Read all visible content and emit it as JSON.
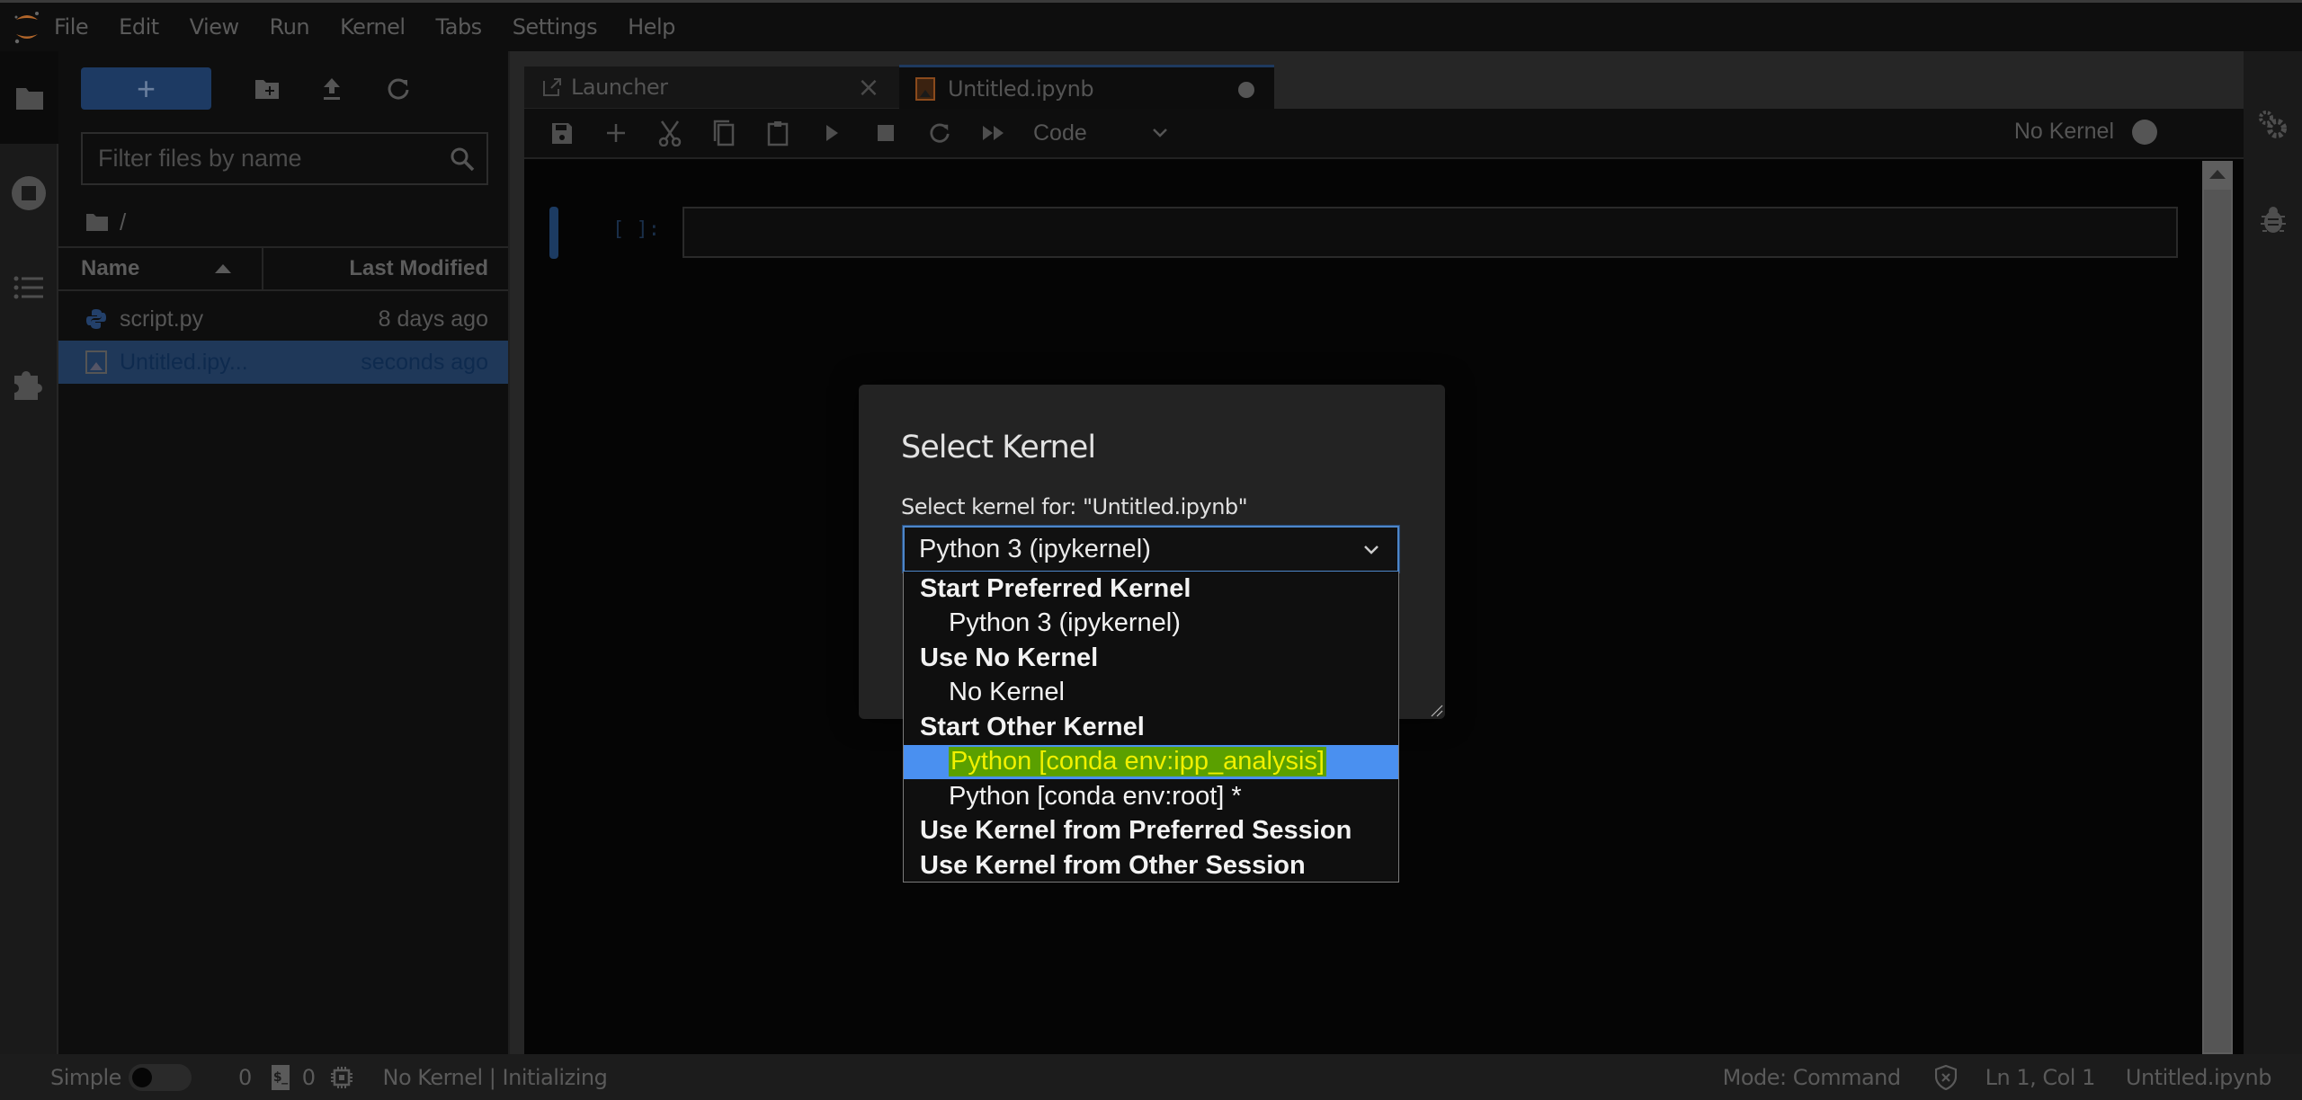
{
  "app": {
    "name": "JupyterLab",
    "accent": "#1d3a63",
    "highlight": "#4a90f0"
  },
  "menubar": {
    "items": [
      "File",
      "Edit",
      "View",
      "Run",
      "Kernel",
      "Tabs",
      "Settings",
      "Help"
    ]
  },
  "filebrowser": {
    "new_label": "+",
    "filter_placeholder": "Filter files by name",
    "breadcrumb": "/",
    "columns": {
      "name": "Name",
      "modified": "Last Modified"
    },
    "files": [
      {
        "name": "script.py",
        "modified": "8 days ago",
        "icon": "python-icon",
        "selected": false
      },
      {
        "name": "Untitled.ipy...",
        "modified": "seconds ago",
        "icon": "notebook-icon",
        "selected": true
      }
    ]
  },
  "tabs": [
    {
      "label": "Launcher",
      "icon": "launcher-icon",
      "close": "×"
    },
    {
      "label": "Untitled.ipynb",
      "icon": "notebook-icon",
      "dirty": true
    }
  ],
  "notebook": {
    "cell_type": "Code",
    "kernel_status": "No Kernel",
    "cell_prompt": "[ ]:"
  },
  "dialog": {
    "title": "Select Kernel",
    "label": "Select kernel for: \"Untitled.ipynb\"",
    "selected_value": "Python 3 (ipykernel)",
    "options": [
      {
        "label": "Start Preferred Kernel",
        "type": "group"
      },
      {
        "label": "Python 3 (ipykernel)",
        "type": "option"
      },
      {
        "label": "Use No Kernel",
        "type": "group"
      },
      {
        "label": "No Kernel",
        "type": "option"
      },
      {
        "label": "Start Other Kernel",
        "type": "group"
      },
      {
        "label": "Python [conda env:ipp_analysis]",
        "type": "option",
        "highlighted": true
      },
      {
        "label": "Python [conda env:root] *",
        "type": "option"
      },
      {
        "label": "Use Kernel from Preferred Session",
        "type": "group"
      },
      {
        "label": "Use Kernel from Other Session",
        "type": "group"
      }
    ]
  },
  "statusbar": {
    "simple_label": "Simple",
    "simple_enabled": false,
    "terminals_count": "0",
    "kernels_count": "0",
    "kernel_text": "No Kernel | Initializing",
    "mode": "Mode: Command",
    "position": "Ln 1, Col 1",
    "filename": "Untitled.ipynb"
  }
}
